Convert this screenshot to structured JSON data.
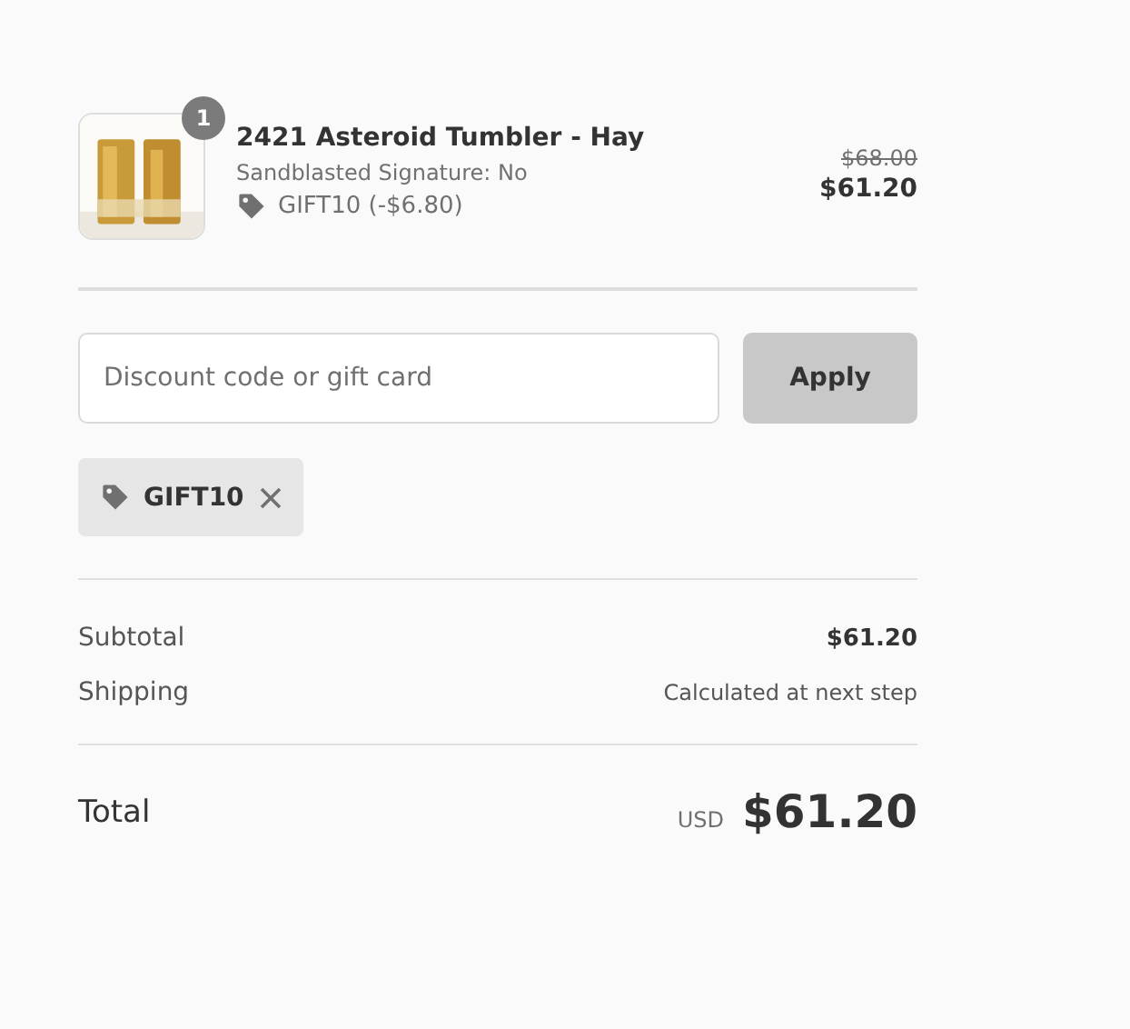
{
  "line_items": [
    {
      "quantity": "1",
      "title": "2421 Asteroid Tumbler - Hay",
      "variant": "Sandblasted Signature: No",
      "discount": "GIFT10 (-$6.80)",
      "original_price": "$68.00",
      "price": "$61.20"
    }
  ],
  "discount_field": {
    "placeholder": "Discount code or gift card"
  },
  "apply_button": "Apply",
  "applied_codes": [
    "GIFT10"
  ],
  "summary": [
    {
      "label": "Subtotal",
      "value": "$61.20",
      "kind": "amount"
    },
    {
      "label": "Shipping",
      "value": "Calculated at next step",
      "kind": "note"
    }
  ],
  "total": {
    "label": "Total",
    "currency": "USD",
    "value": "$61.20"
  }
}
